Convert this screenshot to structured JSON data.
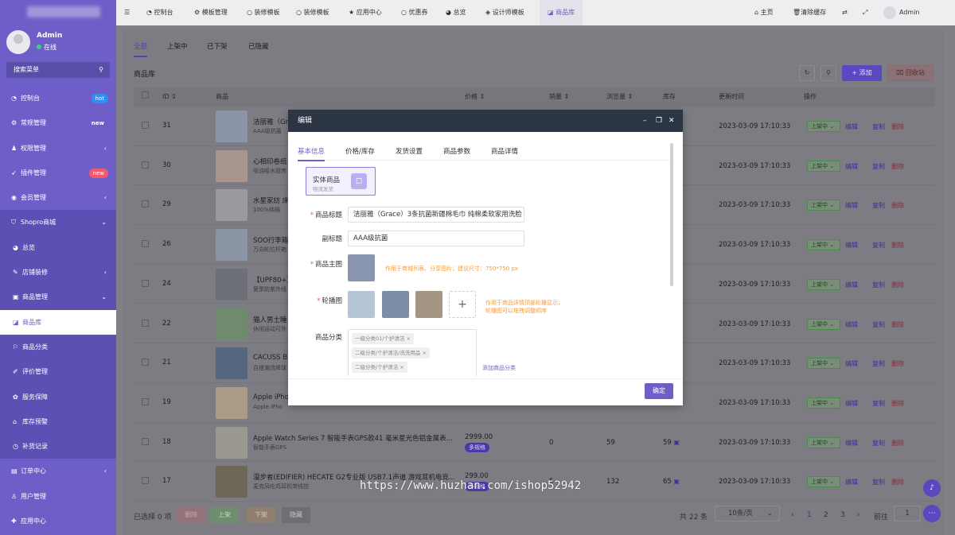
{
  "sidebar": {
    "user_name": "Admin",
    "user_status": "在线",
    "search_placeholder": "搜索菜单",
    "items": [
      {
        "label": "控制台",
        "badge": "hot"
      },
      {
        "label": "常规管理",
        "badge": "new"
      },
      {
        "label": "权限管理"
      },
      {
        "label": "插件管理",
        "badge": "new"
      },
      {
        "label": "会员管理"
      },
      {
        "label": "Shopro商城"
      },
      {
        "label": "总览"
      },
      {
        "label": "店铺装修"
      },
      {
        "label": "商品管理"
      },
      {
        "label": "商品库"
      },
      {
        "label": "商品分类"
      },
      {
        "label": "评价管理"
      },
      {
        "label": "服务保障"
      },
      {
        "label": "库存预警"
      },
      {
        "label": "补货记录"
      },
      {
        "label": "订单中心"
      },
      {
        "label": "用户管理"
      },
      {
        "label": "应用中心"
      }
    ]
  },
  "topbar": {
    "nav": [
      "控制台",
      "模板管理",
      "装修模板",
      "装修模板",
      "应用中心",
      "优惠券",
      "总览",
      "设计师模板",
      "商品库"
    ],
    "home": "主页",
    "clear_cache": "清除缓存",
    "admin": "Admin"
  },
  "tabs": [
    "全部",
    "上架中",
    "已下架",
    "已隐藏"
  ],
  "page_title": "商品库",
  "actions": {
    "add": "添加",
    "recycle": "回收站"
  },
  "table": {
    "headers": {
      "id": "ID",
      "goods": "商品",
      "price": "价格",
      "sales": "销量",
      "views": "浏览量",
      "stock": "库存",
      "updated": "更新时间",
      "ops": "操作"
    },
    "status_label": "上架中",
    "op_edit": "编辑",
    "op_copy": "复制",
    "op_delete": "删除",
    "spec_label": "多规格",
    "rows": [
      {
        "id": "31",
        "name": "洁丽雅（Gr",
        "sub": "AAA级抗菌",
        "time": "2023-03-09 17:10:33",
        "color": "#8c95a8"
      },
      {
        "id": "30",
        "name": "心相印卷纸",
        "sub": "吸油吸水厨房",
        "time": "2023-03-09 17:10:33",
        "color": "#a8968e"
      },
      {
        "id": "29",
        "name": "水星家纺 床",
        "sub": "100%纯棉",
        "time": "2023-03-09 17:10:33",
        "color": "#9a9a9e"
      },
      {
        "id": "26",
        "name": "SOO行李箱",
        "sub": "万向轮拉杆箱",
        "time": "2023-03-09 17:10:33",
        "color": "#8b95a6"
      },
      {
        "id": "24",
        "name": "【UPF80+】",
        "sub": "夏季防紫外线",
        "time": "2023-03-09 17:10:33",
        "color": "#6d7076"
      },
      {
        "id": "22",
        "name": "猫人男士睡",
        "sub": "休闲运动可外",
        "time": "2023-03-09 17:10:33",
        "color": "#6f8a6c"
      },
      {
        "id": "21",
        "name": "CACUSS B",
        "sub": "百搭潮流棒球",
        "time": "2023-03-09 17:10:33",
        "color": "#55677e"
      },
      {
        "id": "19",
        "name": "Apple iPho",
        "sub": "Apple iPho",
        "time": "2023-03-09 17:10:33",
        "color": "#a89c86"
      },
      {
        "id": "18",
        "name": "Apple Watch Series 7 智能手表GPS款41 毫米星光色铝金属表...",
        "sub": "智能手表GPS",
        "price": "2999.00",
        "sales": "0",
        "views": "59",
        "stock": "59",
        "time": "2023-03-09 17:10:33",
        "color": "#9b9890"
      },
      {
        "id": "17",
        "name": "漫步者(EDIFIER) HECATE G2专业版 USB7.1声道 游戏耳机电竞...",
        "sub": "麦克风吃鸡耳机带线控",
        "price": "299.00",
        "sales": "5",
        "views": "132",
        "stock": "65",
        "time": "2023-03-09 17:10:33",
        "color": "#6e6656"
      }
    ]
  },
  "footer": {
    "selected": "已选择 0 项",
    "btn_delete": "删除",
    "btn_up": "上架",
    "btn_down": "下架",
    "btn_hide": "隐藏",
    "total": "共 22 条",
    "page_size": "10条/页",
    "pages": [
      "1",
      "2",
      "3"
    ],
    "goto": "前往",
    "goto_value": "1"
  },
  "modal": {
    "title": "编辑",
    "tabs": [
      "基本信息",
      "价格/库存",
      "发货设置",
      "商品参数",
      "商品详情"
    ],
    "type_title": "实体商品",
    "type_sub": "物流发货",
    "label_title": "商品标题",
    "title_value": "洁丽雅（Grace）3条抗菌新疆棉毛巾 纯棉柔软家用洗脸",
    "label_subtitle": "副标题",
    "subtitle_value": "AAA级抗菌",
    "label_main_img": "商品主图",
    "main_img_hint": "作用于商城列表、分享图片；建议尺寸：750*750 px",
    "label_carousel": "轮播图",
    "carousel_hint1": "作用于商品详情顶部轮播显示，",
    "carousel_hint2": "轮播图可以拖拽调整顺序",
    "label_category": "商品分类",
    "categories": [
      "一级分类01/个护清洁",
      "二级分类/个护清洁/洗洗用品",
      "二级分类/个护清洁"
    ],
    "add_category": "添加商品分类",
    "ok": "确定"
  },
  "watermark": "https://www.huzhan.com/ishop52942"
}
